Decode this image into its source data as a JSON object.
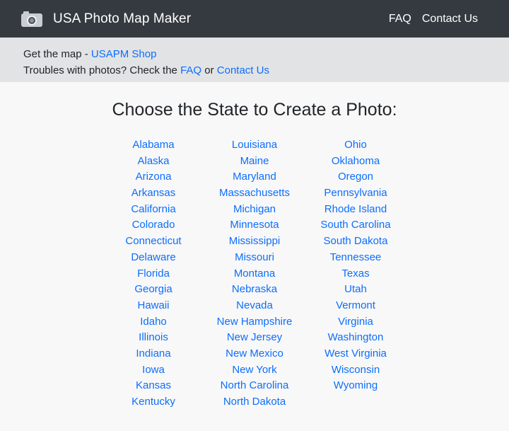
{
  "navbar": {
    "brand": "USA Photo Map Maker",
    "links": [
      "FAQ",
      "Contact Us"
    ]
  },
  "notice": {
    "line1_prefix": "Get the map - ",
    "shop_link": "USAPM Shop",
    "line2_prefix": "Troubles with photos? Check the ",
    "faq_link": "FAQ",
    "or_text": " or ",
    "contact_link": "Contact Us"
  },
  "main": {
    "title": "Choose the State to Create a Photo:",
    "columns": [
      [
        "Alabama",
        "Alaska",
        "Arizona",
        "Arkansas",
        "California",
        "Colorado",
        "Connecticut",
        "Delaware",
        "Florida",
        "Georgia",
        "Hawaii",
        "Idaho",
        "Illinois",
        "Indiana",
        "Iowa",
        "Kansas",
        "Kentucky"
      ],
      [
        "Louisiana",
        "Maine",
        "Maryland",
        "Massachusetts",
        "Michigan",
        "Minnesota",
        "Mississippi",
        "Missouri",
        "Montana",
        "Nebraska",
        "Nevada",
        "New Hampshire",
        "New Jersey",
        "New Mexico",
        "New York",
        "North Carolina",
        "North Dakota"
      ],
      [
        "Ohio",
        "Oklahoma",
        "Oregon",
        "Pennsylvania",
        "Rhode Island",
        "South Carolina",
        "South Dakota",
        "Tennessee",
        "Texas",
        "Utah",
        "Vermont",
        "Virginia",
        "Washington",
        "West Virginia",
        "Wisconsin",
        "Wyoming"
      ]
    ]
  },
  "colors": {
    "navbar_bg": "#343a40",
    "notice_bg": "#e2e3e5",
    "link": "#0d6efd",
    "page_bg": "#f8f8f8"
  },
  "icons": {
    "brand": "camera-icon"
  }
}
